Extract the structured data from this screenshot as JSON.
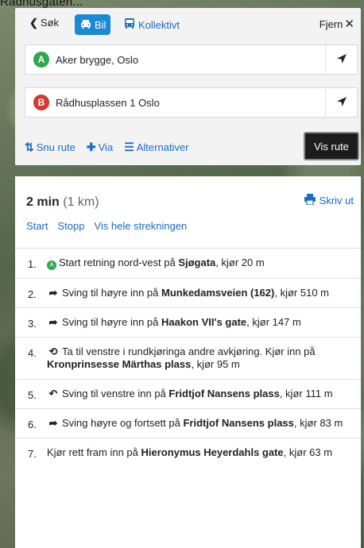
{
  "map_caption": "Rådhusgaten...",
  "mode_bar": {
    "back_label": "Søk",
    "car_label": "Bil",
    "transit_label": "Kollektivt",
    "remove_label": "Fjern"
  },
  "from": {
    "marker": "A",
    "value": "Aker brygge, Oslo"
  },
  "to": {
    "marker": "B",
    "value": "Rådhusplassen 1 Oslo"
  },
  "actions": {
    "swap_label": "Snu rute",
    "via_label": "Via",
    "alternatives_label": "Alternativer",
    "show_route_label": "Vis rute"
  },
  "summary": {
    "time": "2 min",
    "distance": "(1 km)",
    "print_label": "Skriv ut"
  },
  "links": {
    "start": "Start",
    "stop": "Stopp",
    "whole_route": "Vis hele strekningen"
  },
  "steps": [
    {
      "num": "1.",
      "icon": "start-icon",
      "pre": "Start retning nord-vest på ",
      "bold": "Sjøgata",
      "post": ", kjør 20 m",
      "pre2": "",
      "bold2": "",
      "post2": ""
    },
    {
      "num": "2.",
      "icon": "turn-right-icon",
      "pre": "Sving til høyre inn på ",
      "bold": "Munkedamsveien (162)",
      "post": ", kjør 510 m",
      "pre2": "",
      "bold2": "",
      "post2": ""
    },
    {
      "num": "3.",
      "icon": "turn-right-icon",
      "pre": "Sving til høyre inn på ",
      "bold": "Haakon VII's gate",
      "post": ", kjør 147 m",
      "pre2": "",
      "bold2": "",
      "post2": ""
    },
    {
      "num": "4.",
      "icon": "roundabout-icon",
      "pre": "Ta til venstre i rundkjøringa andre avkjøring. Kjør inn på ",
      "bold": "Kronprinsesse Märthas plass",
      "post": ", kjør 95 m",
      "pre2": "",
      "bold2": "",
      "post2": ""
    },
    {
      "num": "5.",
      "icon": "turn-left-icon",
      "pre": "Sving til venstre inn på ",
      "bold": "Fridtjof Nansens plass",
      "post": ", kjør 111 m",
      "pre2": "",
      "bold2": "",
      "post2": ""
    },
    {
      "num": "6.",
      "icon": "turn-right-icon",
      "pre": "Sving høyre og fortsett på ",
      "bold": "Fridtjof Nansens plass",
      "post": ", kjør 83 m",
      "pre2": "",
      "bold2": "",
      "post2": ""
    },
    {
      "num": "7.",
      "icon": "straight-icon",
      "pre": "Kjør rett fram inn på ",
      "bold": "Hieronymus Heyerdahls gate",
      "post": ", kjør 63 m",
      "pre2": "",
      "bold2": "",
      "post2": ""
    }
  ],
  "colors": {
    "accent": "#1a8ad6",
    "link": "#1a6dc2",
    "marker_a": "#2ea84a",
    "marker_b": "#d33a2f"
  }
}
